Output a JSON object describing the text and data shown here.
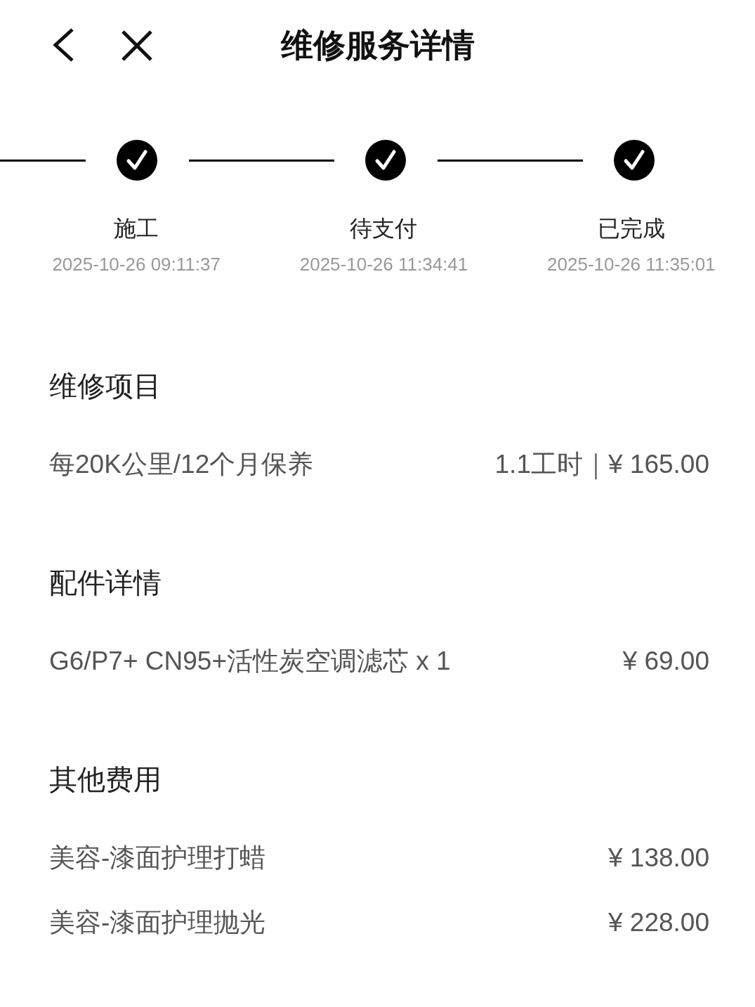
{
  "header": {
    "title": "维修服务详情"
  },
  "steps": [
    {
      "label": "施工",
      "time": "2025-10-26 09:11:37",
      "done": true
    },
    {
      "label": "待支付",
      "time": "2025-10-26 11:34:41",
      "done": true
    },
    {
      "label": "已完成",
      "time": "2025-10-26 11:35:01",
      "done": true
    }
  ],
  "sections": [
    {
      "title": "维修项目",
      "items": [
        {
          "name": "每20K公里/12个月保养",
          "value": "1.1工时｜¥ 165.00"
        }
      ]
    },
    {
      "title": "配件详情",
      "items": [
        {
          "name": "G6/P7+ CN95+活性炭空调滤芯 x 1",
          "value": "¥ 69.00"
        }
      ]
    },
    {
      "title": "其他费用",
      "items": [
        {
          "name": "美容-漆面护理打蜡",
          "value": "¥ 138.00"
        },
        {
          "name": "美容-漆面护理抛光",
          "value": "¥ 228.00"
        }
      ]
    }
  ]
}
